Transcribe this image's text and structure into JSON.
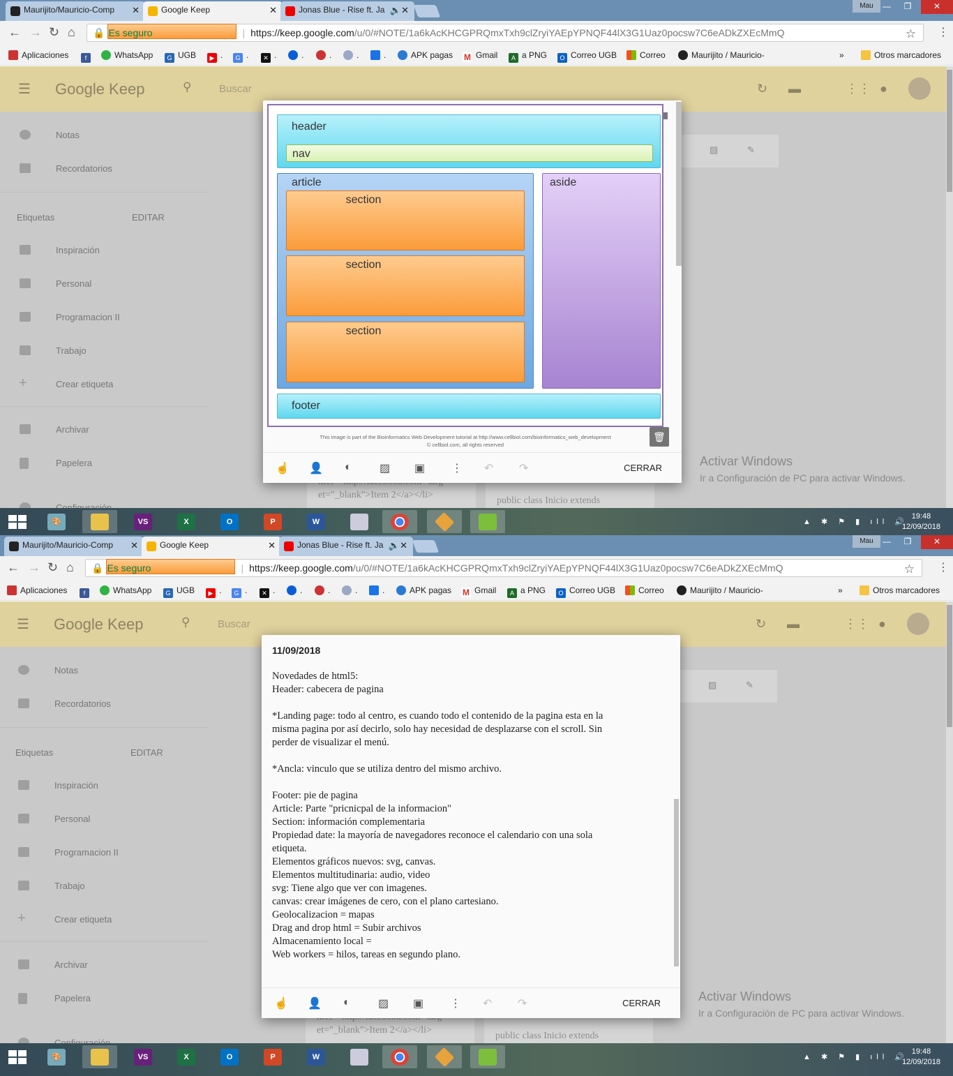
{
  "browser": {
    "tabs": [
      {
        "title": "Maurijito/Mauricio-Comp"
      },
      {
        "title": "Google Keep"
      },
      {
        "title": "Jonas Blue - Rise ft. Ja"
      }
    ],
    "window_user": "Mau",
    "address": {
      "secure_label": "Es seguro",
      "host": "https://keep.google.com",
      "path": "/u/0/#NOTE/1a6kAcKHCGPRQmxTxh9clZryiYAEpYPNQF44lX3G1Uaz0pocsw7C6eADkZXEcMmQ"
    },
    "bookmarks": [
      {
        "label": "Aplicaciones"
      },
      {
        "label": ""
      },
      {
        "label": "WhatsApp"
      },
      {
        "label": "UGB"
      },
      {
        "label": "."
      },
      {
        "label": "."
      },
      {
        "label": "."
      },
      {
        "label": "."
      },
      {
        "label": "."
      },
      {
        "label": "."
      },
      {
        "label": "."
      },
      {
        "label": "APK pagas"
      },
      {
        "label": "Gmail"
      },
      {
        "label": "a PNG"
      },
      {
        "label": "Correo UGB"
      },
      {
        "label": "Correo"
      },
      {
        "label": "Maurijito / Mauricio-"
      },
      {
        "label": "»"
      },
      {
        "label": "Otros marcadores"
      }
    ]
  },
  "keep": {
    "logo": "Google Keep",
    "search_placeholder": "Buscar",
    "sidebar": {
      "notes": "Notas",
      "reminders": "Recordatorios",
      "labels_title": "Etiquetas",
      "edit": "EDITAR",
      "labels": [
        "Inspiración",
        "Personal",
        "Programacion II",
        "Trabajo"
      ],
      "create_label": "Crear etiqueta",
      "archive": "Archivar",
      "trash": "Papelera",
      "settings": "Configuración"
    },
    "bg_text": {
      "line1": "href=\"http://facebook.com\" targ",
      "line2": "et=\"_blank\">Item 2</a></li>",
      "line3": "public class Inicio extends"
    },
    "activate_windows": {
      "title": "Activar Windows",
      "subtitle": "Ir a Configuración de PC para activar Windows."
    },
    "close_label": "CERRAR"
  },
  "diagram": {
    "header": "header",
    "nav": "nav",
    "article": "article",
    "sections": [
      "section",
      "section",
      "section"
    ],
    "aside": "aside",
    "footer": "footer",
    "credit_line1": "This image is part of the Bioinformatics Web Development tutorial at  http://www.cellbiol.com/bioinformatics_web_development",
    "credit_line2": "© cellbiol.com, all rights reserved"
  },
  "note": {
    "title": "11/09/2018",
    "lines": [
      "Novedades de html5:",
      "Header: cabecera de pagina",
      "",
      "*Landing page: todo al centro, es cuando todo el contenido de la pagina esta en la",
      "misma pagina por así decirlo, solo hay necesidad de desplazarse con el scroll. Sin",
      "perder de visualizar el menú.",
      "",
      "*Ancla: vinculo que se utiliza dentro del mismo archivo.",
      "",
      "Footer: pie de pagina",
      "Article: Parte \"pricnicpal de la informacion\"",
      "Section: información complementaria",
      "Propiedad date: la mayoría de navegadores reconoce el calendario con una sola",
      "etiqueta.",
      "Elementos gráficos nuevos: svg, canvas.",
      "Elementos multitudinaria: audio, video",
      "svg: Tiene algo que ver con imagenes.",
      "canvas: crear imágenes de cero, con el plano cartesiano.",
      "Geolocalizacion = mapas",
      "Drag and drop html = Subir archivos",
      "Almacenamiento local =",
      "Web workers = hilos, tareas en segundo plano."
    ]
  },
  "taskbar": {
    "time": "19:48",
    "date": "12/09/2018"
  },
  "colors": {
    "keep_header": "#e0d29d",
    "tab_strip": "#6b8fb3",
    "secure_green": "#0b8043"
  }
}
